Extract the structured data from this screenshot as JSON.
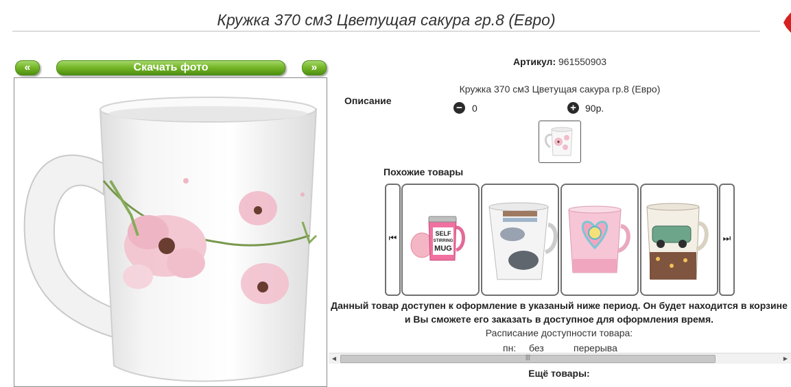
{
  "header": {
    "title": "Кружка 370 см3 Цветущая сакура гр.8 (Евро)"
  },
  "gallery": {
    "prev_label": "«",
    "download_label": "Скачать фото",
    "next_label": "»"
  },
  "product": {
    "article_label": "Артикул:",
    "article_value": "961550903",
    "description_label": "Описание",
    "description_text": "Кружка 370 см3 Цветущая сакура гр.8 (Евро)",
    "quantity": "0",
    "price": "90р."
  },
  "similar": {
    "title": "Похожие товары",
    "items": [
      {
        "icon": "self-stirring-mug-image",
        "text": "SELF STIRRING MUG"
      },
      {
        "icon": "fashion-mug-image"
      },
      {
        "icon": "heart-mug-image"
      },
      {
        "icon": "car-mug-image"
      }
    ]
  },
  "availability": {
    "notice": "Данный товар доступен к оформление в указаный ниже период. Он будет находится в корзине и Вы сможете его заказать в доступное для оформления время.",
    "schedule_label": "Расписание доступности товара:",
    "schedule_day": "пн:",
    "schedule_without": "без",
    "schedule_break": "перерыва"
  },
  "more_label": "Ещё товары:",
  "colors": {
    "accent_green": "#6aad22",
    "border": "#6f6f6f"
  }
}
